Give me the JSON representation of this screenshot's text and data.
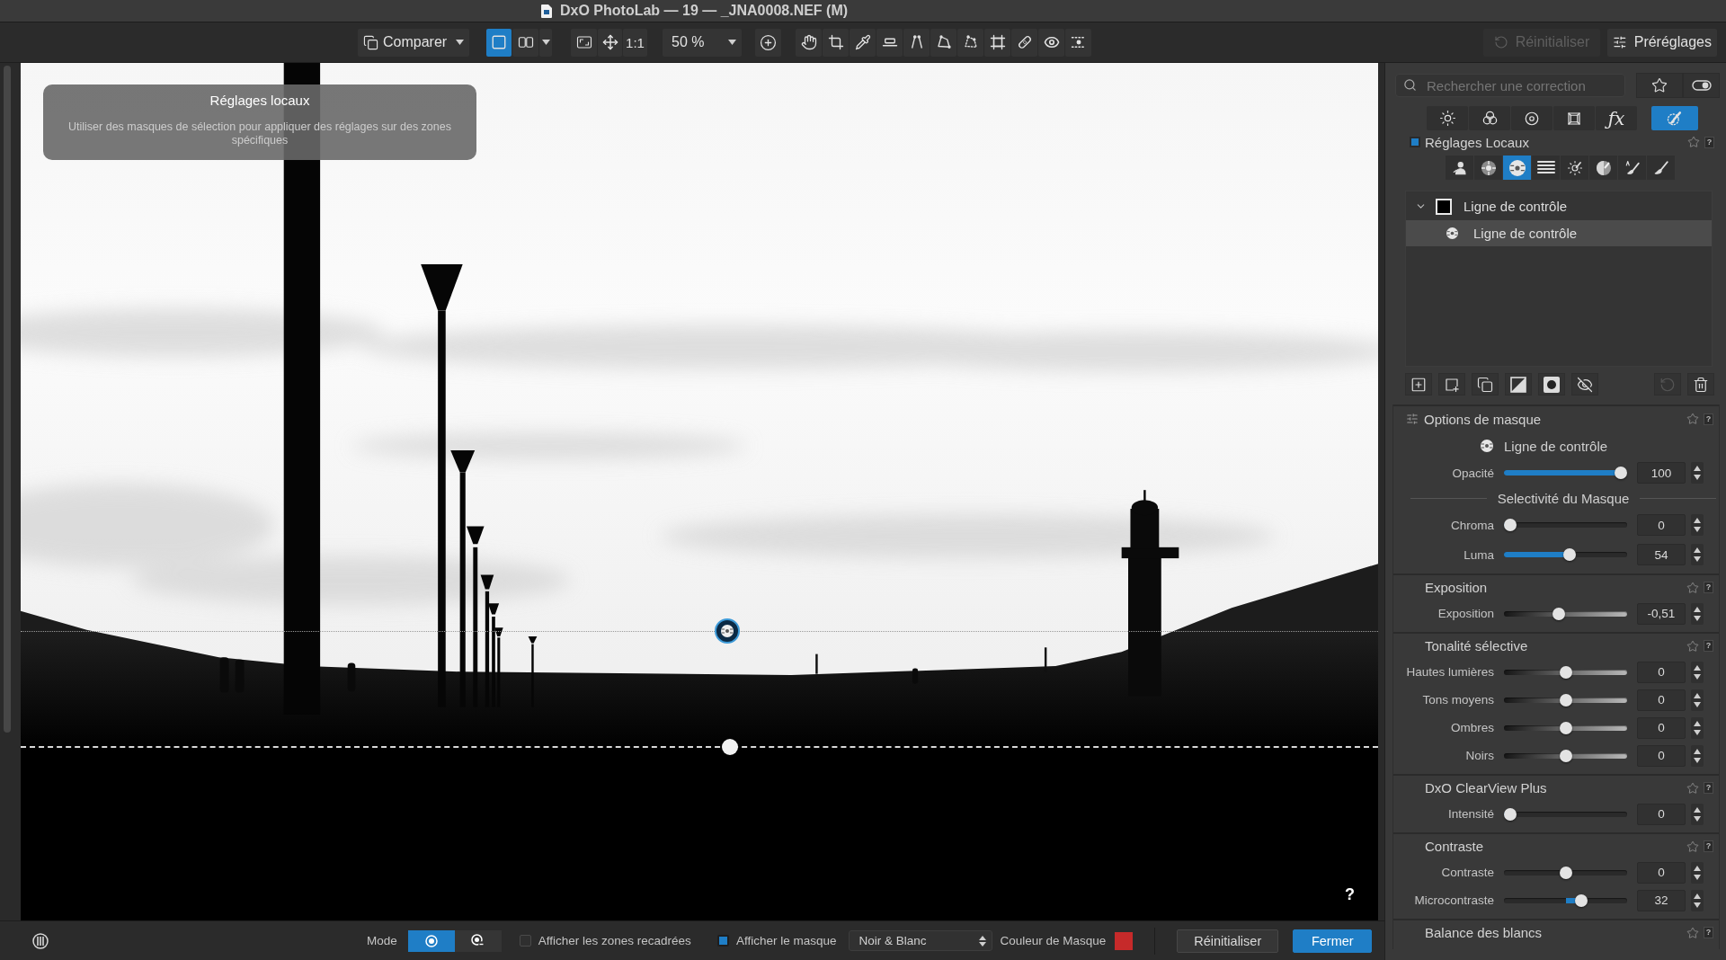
{
  "window": {
    "title": "DxO PhotoLab — 19 — _JNA0008.NEF (M)"
  },
  "toolbar": {
    "compare": {
      "label": "Comparer"
    },
    "view_modes": [
      {
        "selected": true
      },
      {
        "selected": false
      }
    ],
    "actual_size": "1:1",
    "zoom": {
      "value": "50 %"
    },
    "reset": {
      "label": "Réinitialiser",
      "disabled": true
    },
    "presets": {
      "label": "Préréglages"
    }
  },
  "viewer": {
    "tooltip": {
      "title": "Réglages locaux",
      "text": "Utiliser des masques de sélection pour appliquer des réglages sur des zones spécifiques"
    },
    "help": "?"
  },
  "side_panel": {
    "search": {
      "placeholder": "Rechercher une correction"
    },
    "palette_tabs": [
      {
        "selected": false
      },
      {
        "selected": false
      },
      {
        "selected": false
      },
      {
        "selected": false
      },
      {
        "glyph": "ƒx",
        "selected": false
      },
      {
        "selected": true
      }
    ],
    "local": {
      "title": "Réglages Locaux",
      "enabled": true,
      "help": "?",
      "tools": [
        {
          "selected": false
        },
        {
          "selected": false
        },
        {
          "selected": true
        },
        {
          "selected": false
        },
        {
          "selected": false
        },
        {
          "selected": false
        },
        {
          "selected": false
        },
        {
          "selected": false
        }
      ],
      "masks": [
        {
          "label": "Ligne de contrôle",
          "checked": false,
          "expanded": true,
          "selected": false,
          "children": [
            {
              "label": "Ligne de contrôle",
              "selected": true
            }
          ]
        }
      ],
      "undo": {
        "disabled": true
      }
    },
    "mask_options": {
      "title": "Options de masque",
      "help": "?",
      "mask_name": "Ligne de contrôle",
      "opacity": {
        "label": "Opacité",
        "kind": "fill",
        "level": 1,
        "value": "100"
      },
      "selectivity": {
        "title": "Selectivité du Masque",
        "sliders": [
          {
            "label": "Chroma",
            "kind": "fill",
            "level": 0,
            "value": "0"
          },
          {
            "label": "Luma",
            "kind": "fill",
            "level": 0.54,
            "value": "54"
          }
        ]
      }
    },
    "sections": [
      {
        "title": "Exposition",
        "help": "?",
        "sliders": [
          {
            "label": "Exposition",
            "kind": "gradient",
            "level": 0.44,
            "value": "-0,51"
          }
        ]
      },
      {
        "title": "Tonalité sélective",
        "help": "?",
        "sliders": [
          {
            "label": "Hautes lumières",
            "kind": "gradient",
            "level": 0.5,
            "value": "0"
          },
          {
            "label": "Tons moyens",
            "kind": "gradient",
            "level": 0.5,
            "value": "0"
          },
          {
            "label": "Ombres",
            "kind": "gradient",
            "level": 0.5,
            "value": "0"
          },
          {
            "label": "Noirs",
            "kind": "gradient",
            "level": 0.5,
            "value": "0"
          }
        ]
      },
      {
        "title": "DxO ClearView Plus",
        "help": "?",
        "sliders": [
          {
            "label": "Intensité",
            "kind": "fill",
            "level": 0,
            "value": "0"
          }
        ]
      },
      {
        "title": "Contraste",
        "help": "?",
        "sliders": [
          {
            "label": "Contraste",
            "kind": "bipolar",
            "level": 0.5,
            "value": "0"
          },
          {
            "label": "Microcontraste",
            "kind": "bipolar",
            "level": 0.64,
            "value": "32"
          }
        ]
      },
      {
        "title": "Balance des blancs",
        "help": "?"
      }
    ]
  },
  "bottom_bar": {
    "mode": {
      "label": "Mode",
      "options": [
        {
          "selected": true
        },
        {
          "selected": false
        }
      ]
    },
    "checkboxes": [
      {
        "label": "Afficher les zones recadrées",
        "checked": false
      },
      {
        "label": "Afficher le masque",
        "checked": true
      }
    ],
    "display": {
      "value": "Noir & Blanc"
    },
    "mask_color": {
      "label": "Couleur de Masque",
      "color": "#c62a2a"
    },
    "buttons": [
      {
        "label": "Réinitialiser",
        "primary": false
      },
      {
        "label": "Fermer",
        "primary": true
      }
    ]
  }
}
